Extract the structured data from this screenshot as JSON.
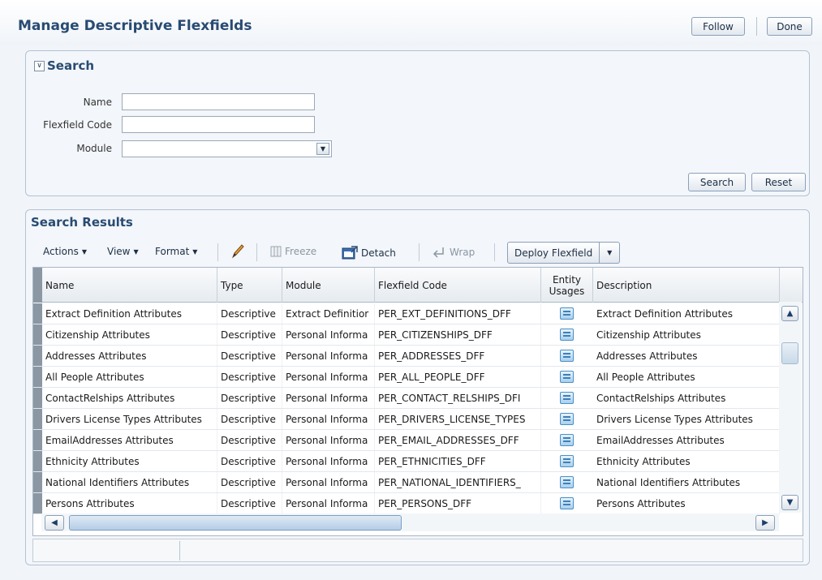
{
  "page": {
    "title": "Manage Descriptive Flexfields",
    "follow_label": "Follow",
    "done_label": "Done"
  },
  "search": {
    "title": "Search",
    "fields": {
      "name_label": "Name",
      "name_value": "",
      "code_label": "Flexfield Code",
      "code_value": "",
      "module_label": "Module",
      "module_value": ""
    },
    "search_button": "Search",
    "reset_button": "Reset"
  },
  "results": {
    "title": "Search Results",
    "toolbar": {
      "actions": "Actions",
      "view": "View",
      "format": "Format",
      "freeze": "Freeze",
      "detach": "Detach",
      "wrap": "Wrap",
      "deploy": "Deploy Flexfield"
    },
    "columns": [
      "Name",
      "Type",
      "Module",
      "Flexfield Code",
      "Entity Usages",
      "Description"
    ],
    "rows": [
      {
        "name": "Extract Definition Attributes",
        "type": "Descriptive",
        "module": "Extract Definitior",
        "code": "PER_EXT_DEFINITIONS_DFF",
        "description": "Extract Definition Attributes"
      },
      {
        "name": "Citizenship Attributes",
        "type": "Descriptive",
        "module": "Personal Informa",
        "code": "PER_CITIZENSHIPS_DFF",
        "description": "Citizenship Attributes"
      },
      {
        "name": "Addresses Attributes",
        "type": "Descriptive",
        "module": "Personal Informa",
        "code": "PER_ADDRESSES_DFF",
        "description": "Addresses Attributes"
      },
      {
        "name": "All People Attributes",
        "type": "Descriptive",
        "module": "Personal Informa",
        "code": "PER_ALL_PEOPLE_DFF",
        "description": "All People Attributes"
      },
      {
        "name": "ContactRelships Attributes",
        "type": "Descriptive",
        "module": "Personal Informa",
        "code": "PER_CONTACT_RELSHIPS_DFI",
        "description": "ContactRelships Attributes"
      },
      {
        "name": "Drivers License Types Attributes",
        "type": "Descriptive",
        "module": "Personal Informa",
        "code": "PER_DRIVERS_LICENSE_TYPES",
        "description": "Drivers License Types Attributes"
      },
      {
        "name": "EmailAddresses Attributes",
        "type": "Descriptive",
        "module": "Personal Informa",
        "code": "PER_EMAIL_ADDRESSES_DFF",
        "description": "EmailAddresses Attributes"
      },
      {
        "name": "Ethnicity Attributes",
        "type": "Descriptive",
        "module": "Personal Informa",
        "code": "PER_ETHNICITIES_DFF",
        "description": "Ethnicity Attributes"
      },
      {
        "name": "National Identifiers Attributes",
        "type": "Descriptive",
        "module": "Personal Informa",
        "code": "PER_NATIONAL_IDENTIFIERS_",
        "description": "National Identifiers Attributes"
      },
      {
        "name": "Persons Attributes",
        "type": "Descriptive",
        "module": "Personal Informa",
        "code": "PER_PERSONS_DFF",
        "description": "Persons Attributes"
      }
    ]
  },
  "colors": {
    "title": "#284b72",
    "panel_border": "#b3c2d2",
    "entity_icon": "#4a8fc7"
  }
}
